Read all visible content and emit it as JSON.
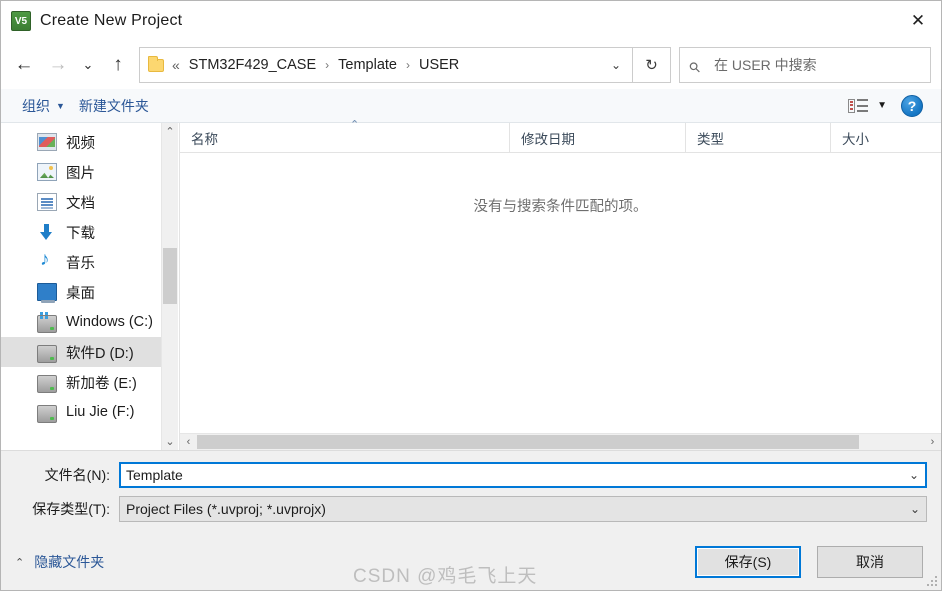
{
  "window": {
    "title": "Create New Project",
    "app_icon": "keil-uvision-icon",
    "close_label": "✕"
  },
  "nav": {
    "back_label": "←",
    "forward_label": "→",
    "recent_label": "⌄",
    "up_label": "↑",
    "refresh_label": "↻",
    "address_chevron": "⌄",
    "prefix": "«",
    "crumbs": [
      "STM32F429_CASE",
      "Template",
      "USER"
    ],
    "separator": "›"
  },
  "search": {
    "placeholder": "在 USER 中搜索",
    "icon": "search-icon"
  },
  "toolbar": {
    "organize_label": "组织",
    "organize_caret": "▼",
    "new_folder_label": "新建文件夹",
    "view_caret": "▼",
    "help_label": "?"
  },
  "sidebar": {
    "items": [
      {
        "label": "视频",
        "icon": "videos-icon",
        "selected": false
      },
      {
        "label": "图片",
        "icon": "pictures-icon",
        "selected": false
      },
      {
        "label": "文档",
        "icon": "documents-icon",
        "selected": false
      },
      {
        "label": "下载",
        "icon": "downloads-icon",
        "selected": false
      },
      {
        "label": "音乐",
        "icon": "music-icon",
        "selected": false
      },
      {
        "label": "桌面",
        "icon": "desktop-icon",
        "selected": false
      },
      {
        "label": "Windows (C:)",
        "icon": "windows-drive-icon",
        "selected": false
      },
      {
        "label": "软件D (D:)",
        "icon": "drive-icon",
        "selected": true
      },
      {
        "label": "新加卷 (E:)",
        "icon": "drive-icon",
        "selected": false
      },
      {
        "label": "Liu Jie  (F:)",
        "icon": "drive-icon",
        "selected": false
      }
    ],
    "scroll_up": "⌃",
    "scroll_down": "⌄"
  },
  "filelist": {
    "columns": [
      {
        "label": "名称"
      },
      {
        "label": "修改日期"
      },
      {
        "label": "类型"
      },
      {
        "label": "大小"
      }
    ],
    "sort_caret": "⌃",
    "rows": [],
    "empty_message": "没有与搜索条件匹配的项。",
    "scroll_left": "‹",
    "scroll_right": "›"
  },
  "form": {
    "filename_label": "文件名(N):",
    "filename_value": "Template",
    "filetype_label": "保存类型(T):",
    "filetype_value": "Project Files (*.uvproj; *.uvprojx)",
    "chevron": "⌄"
  },
  "footer": {
    "hide_folders_label": "隐藏文件夹",
    "hide_folders_caret": "⌃",
    "save_label": "保存(S)",
    "cancel_label": "取消"
  },
  "watermark": {
    "text": "CSDN @鸡毛飞上天"
  },
  "colors": {
    "accent": "#0078d7",
    "link": "#2b5797",
    "selection": "#e0e0e0",
    "chrome": "#f0f0f0"
  }
}
